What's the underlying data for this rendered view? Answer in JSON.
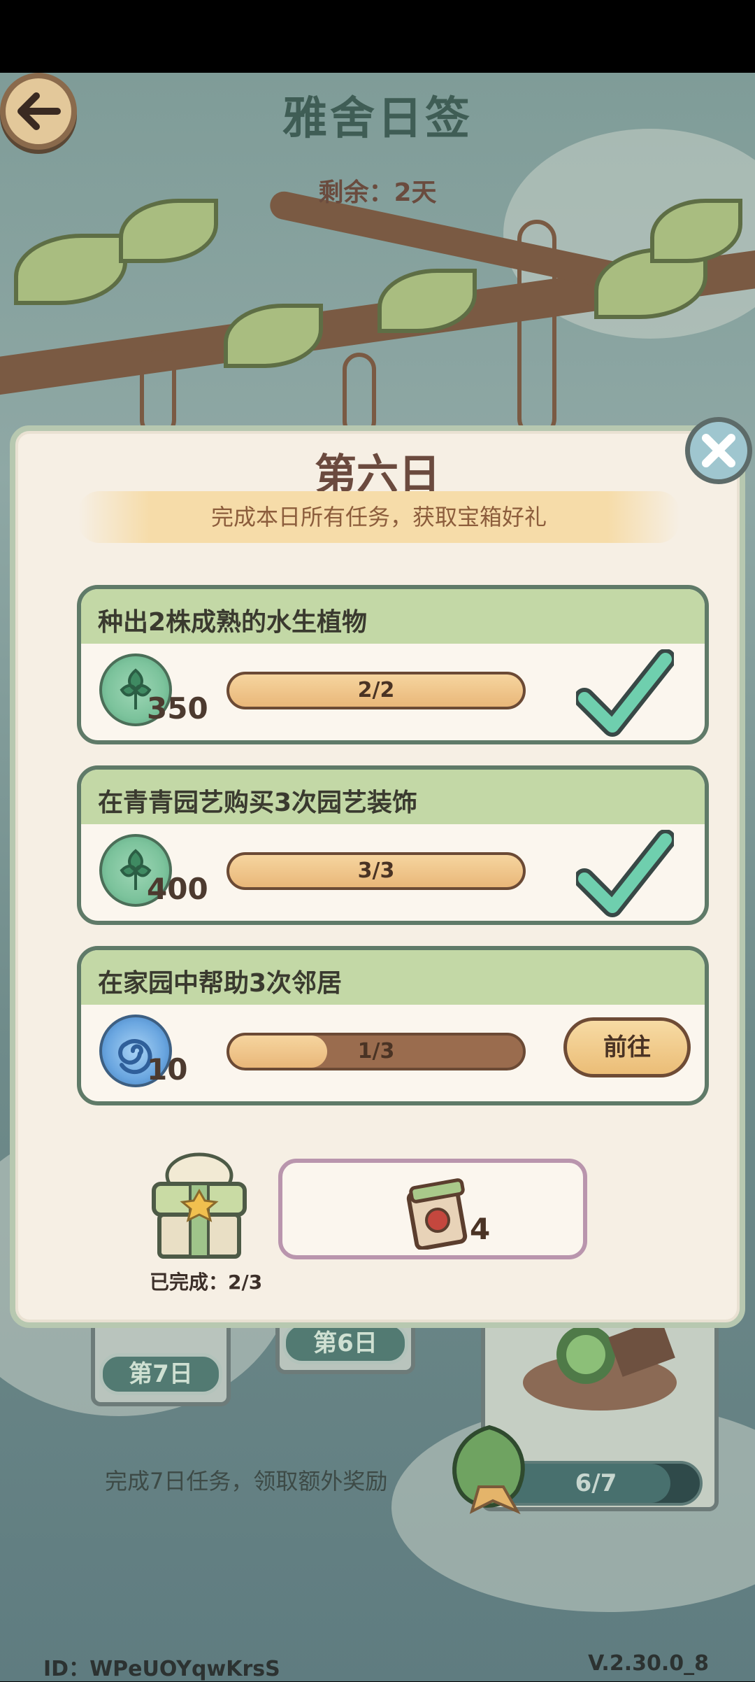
{
  "header": {
    "title": "雅舍日签",
    "remaining": "剩余：2天"
  },
  "modal": {
    "title": "第六日",
    "subtitle": "完成本日所有任务，获取宝箱好礼",
    "tasks": [
      {
        "title": "种出2株成熟的水生植物",
        "reward_icon": "clover-coin-icon",
        "reward_count": "350",
        "progress_text": "2/2",
        "progress": 1.0,
        "status": "completed"
      },
      {
        "title": "在青青园艺购买3次园艺装饰",
        "reward_icon": "clover-coin-icon",
        "reward_count": "400",
        "progress_text": "3/3",
        "progress": 1.0,
        "status": "completed"
      },
      {
        "title": "在家园中帮助3次邻居",
        "reward_icon": "swirl-orb-icon",
        "reward_count": "10",
        "progress_text": "1/3",
        "progress": 0.333,
        "status": "in-progress",
        "action_label": "前往"
      }
    ],
    "chest": {
      "completed_label": "已完成：2/3"
    },
    "reward": {
      "icon": "seed-packet-icon",
      "count": "4"
    }
  },
  "background": {
    "day7": "第7日",
    "day6": "第6日",
    "bonus_tip": "完成7日任务，领取额外奖励",
    "overall_progress_text": "6/7",
    "overall_progress": 0.857
  },
  "footer": {
    "id_label": "ID：WPeUOYqwKrsS",
    "version": "V.2.30.0_8"
  },
  "colors": {
    "title_green": "#3f5d55",
    "task_header": "#c3d8a6",
    "bar_fill": "#e9b779",
    "check_teal": "#6fcfae"
  }
}
